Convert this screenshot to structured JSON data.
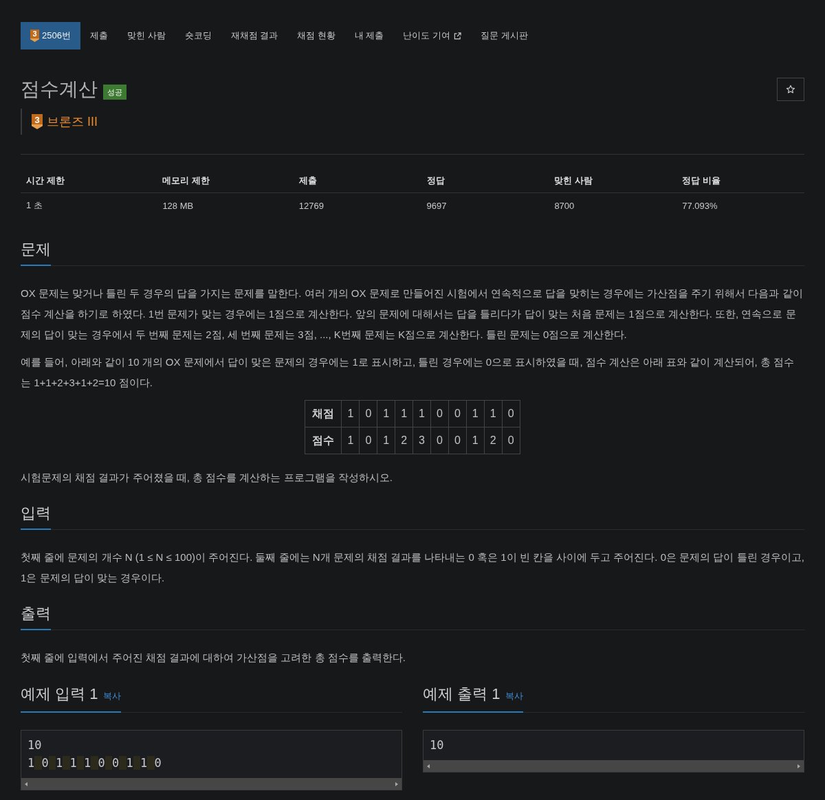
{
  "nav": {
    "tabs": [
      {
        "label": "2506번",
        "badge": "3",
        "selected": true,
        "kind": "link"
      },
      {
        "label": "제출",
        "selected": false,
        "kind": "link"
      },
      {
        "label": "맞힌 사람",
        "selected": false,
        "kind": "link"
      },
      {
        "label": "숏코딩",
        "selected": false,
        "kind": "link"
      },
      {
        "label": "재채점 결과",
        "selected": false,
        "kind": "link"
      },
      {
        "label": "채점 현황",
        "selected": false,
        "kind": "link"
      },
      {
        "label": "내 제출",
        "selected": false,
        "kind": "link"
      },
      {
        "label": "난이도 기여",
        "selected": false,
        "kind": "external"
      },
      {
        "label": "질문 게시판",
        "selected": false,
        "kind": "link"
      }
    ]
  },
  "problem": {
    "title": "점수계산",
    "result_badge": "성공",
    "tier": {
      "number": "3",
      "name": "브론즈 III"
    }
  },
  "stats": {
    "columns": [
      "시간 제한",
      "메모리 제한",
      "제출",
      "정답",
      "맞힌 사람",
      "정답 비율"
    ],
    "rows": [
      [
        "1 초",
        "128 MB",
        "12769",
        "9697",
        "8700",
        "77.093%"
      ]
    ]
  },
  "sections": [
    {
      "title": "문제",
      "blocks": [
        {
          "kind": "paragraph",
          "text": "OX 문제는 맞거나 틀린 두 경우의 답을 가지는 문제를 말한다. 여러 개의 OX 문제로 만들어진 시험에서 연속적으로 답을 맞히는 경우에는 가산점을 주기 위해서 다음과 같이 점수 계산을 하기로 하였다. 1번 문제가 맞는 경우에는 1점으로 계산한다. 앞의 문제에 대해서는 답을 틀리다가 답이 맞는 처음 문제는 1점으로 계산한다. 또한, 연속으로 문제의 답이 맞는 경우에서 두 번째 문제는 2점, 세 번째 문제는 3점, ..., K번째 문제는 K점으로 계산한다. 틀린 문제는 0점으로 계산한다."
        },
        {
          "kind": "paragraph",
          "text": "예를 들어, 아래와 같이 10 개의 OX 문제에서 답이 맞은 문제의 경우에는 1로 표시하고, 틀린 경우에는 0으로 표시하였을 때, 점수 계산은 아래 표와 같이 계산되어, 총 점수는 1+1+2+3+1+2=10 점이다."
        },
        {
          "kind": "table",
          "rows": [
            {
              "header": "채점",
              "cells": [
                "1",
                "0",
                "1",
                "1",
                "1",
                "0",
                "0",
                "1",
                "1",
                "0"
              ]
            },
            {
              "header": "점수",
              "cells": [
                "1",
                "0",
                "1",
                "2",
                "3",
                "0",
                "0",
                "1",
                "2",
                "0"
              ]
            }
          ]
        },
        {
          "kind": "paragraph",
          "text": "시험문제의 채점 결과가 주어졌을 때, 총 점수를 계산하는 프로그램을 작성하시오."
        }
      ]
    },
    {
      "title": "입력",
      "blocks": [
        {
          "kind": "paragraph",
          "text": "첫째 줄에 문제의 개수 N (1 ≤ N ≤ 100)이 주어진다. 둘째 줄에는 N개 문제의 채점 결과를 나타내는 0 혹은 1이 빈 칸을 사이에 두고 주어진다. 0은 문제의 답이 틀린 경우이고, 1은 문제의 답이 맞는 경우이다."
        }
      ]
    },
    {
      "title": "출력",
      "blocks": [
        {
          "kind": "paragraph",
          "text": "첫째 줄에 입력에서 주어진 채점 결과에 대하여 가산점을 고려한 총 점수를 출력한다."
        }
      ]
    }
  ],
  "samples": [
    {
      "title": "예제 입력 1",
      "copy_label": "복사",
      "lines": [
        "10",
        "1 0 1 1 1 0 0 1 1 0"
      ]
    },
    {
      "title": "예제 출력 1",
      "copy_label": "복사",
      "lines": [
        "10"
      ]
    }
  ]
}
